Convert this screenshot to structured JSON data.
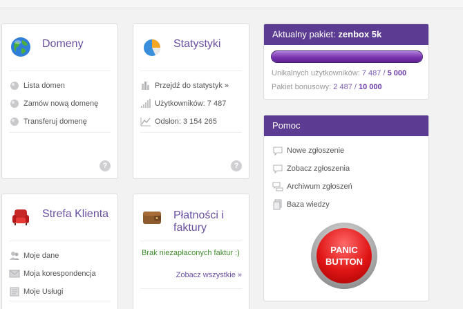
{
  "domeny": {
    "title": "Domeny",
    "links": [
      "Lista domen",
      "Zamów nową domenę",
      "Transferuj domenę"
    ],
    "help": "?"
  },
  "statystyki": {
    "title": "Statystyki",
    "link": "Przejdź do statystyk »",
    "users": "Użytkowników: 7 487",
    "views": "Odsłon: 3 154 265",
    "help": "?"
  },
  "strefa": {
    "title": "Strefa Klienta",
    "links": [
      "Moje dane",
      "Moja korespondencja",
      "Moje Usługi"
    ]
  },
  "platnosci": {
    "title_line1": "Płatności i",
    "title_line2": "faktury",
    "status": "Brak niezapłaconych faktur :)",
    "see_all": "Zobacz wszystkie »"
  },
  "pakiet": {
    "header_prefix": "Aktualny pakiet:",
    "header_name": "zenbox 5k",
    "progress_fraction": 1.0,
    "unique_label": "Unikalnych użytkowników:",
    "unique_value": "7 487",
    "unique_sep": "/",
    "unique_limit": "5 000",
    "bonus_label": "Pakiet bonusowy:",
    "bonus_value": "2 487",
    "bonus_sep": "/",
    "bonus_limit": "10 000"
  },
  "pomoc": {
    "title": "Pomoc",
    "links": [
      "Nowe zgłoszenie",
      "Zobacz zgłoszenia",
      "Archiwum zgłoszeń",
      "Baza wiedzy"
    ],
    "panic_line1": "PANIC",
    "panic_line2": "BUTTON"
  },
  "colors": {
    "accent": "#5b3c92",
    "title": "#6a4fa1",
    "status_green": "#3e8a2a"
  }
}
